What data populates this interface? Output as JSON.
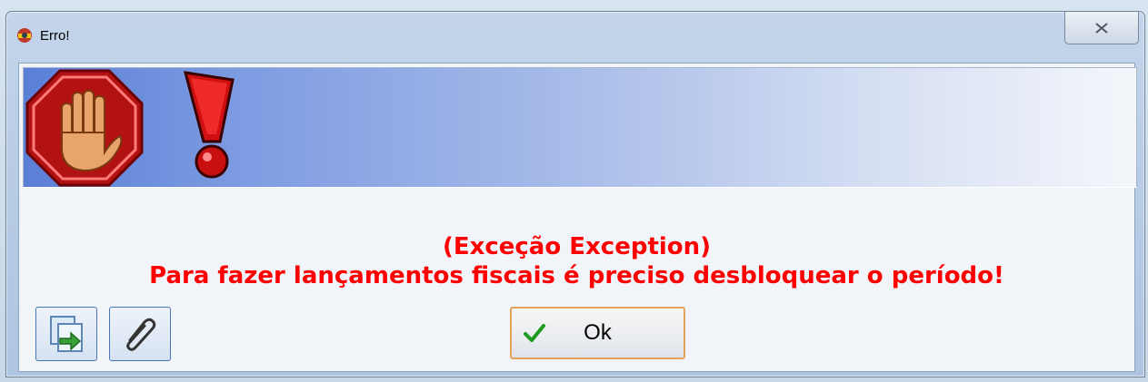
{
  "window": {
    "title": "Erro!",
    "close_icon": "close-x-icon"
  },
  "banner": {
    "icons": [
      "stop-hand-icon",
      "exclamation-icon"
    ]
  },
  "message": {
    "line1": "(Exceção Exception)",
    "line2": "Para fazer lançamentos fiscais é preciso desbloquear o período!",
    "color": "#ff0000"
  },
  "toolbar": {
    "copy_icon": "copy-export-icon",
    "attach_icon": "paperclip-icon"
  },
  "ok_button": {
    "label": "Ok",
    "icon": "checkmark-icon"
  }
}
